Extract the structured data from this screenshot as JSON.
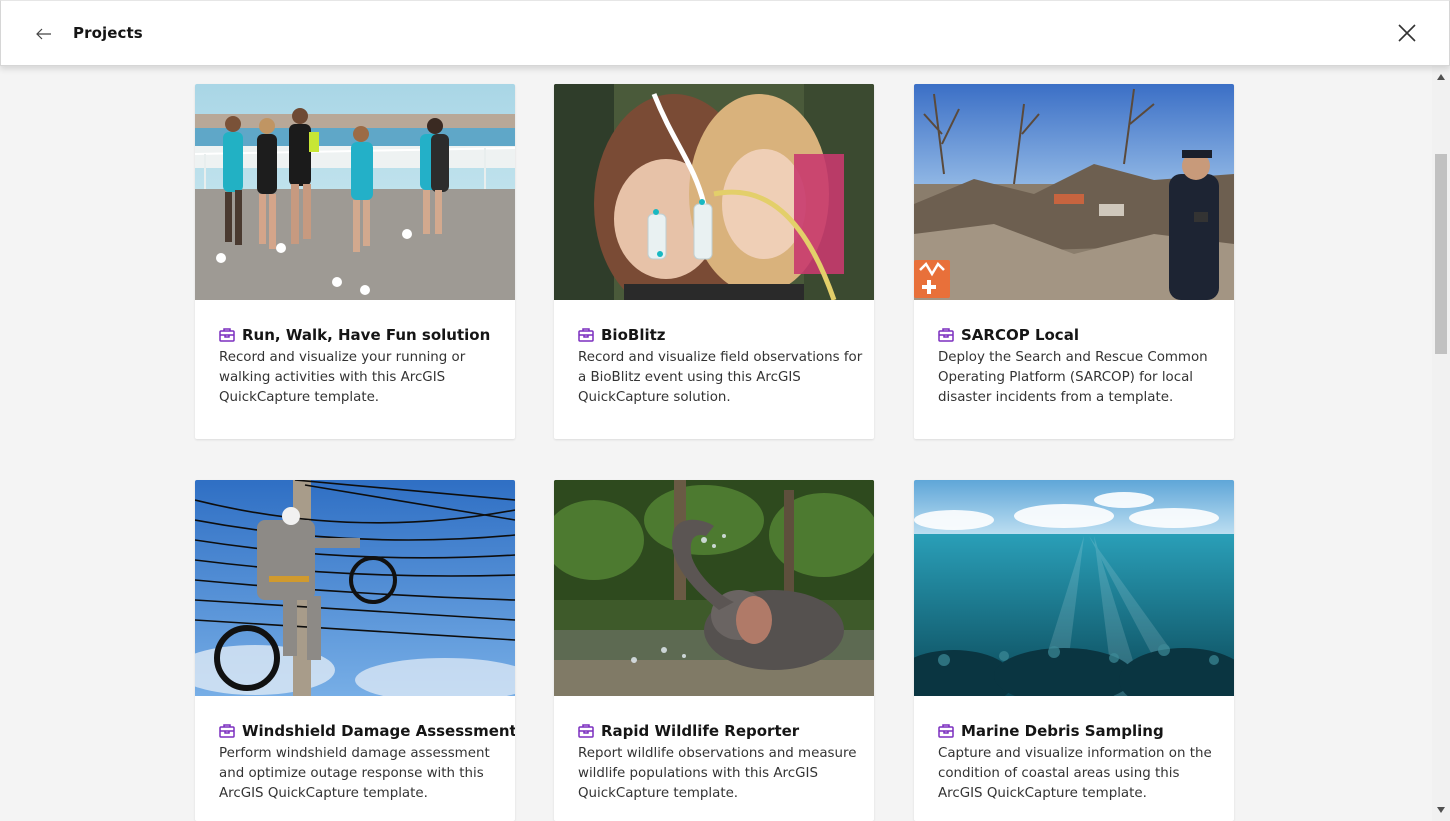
{
  "header": {
    "title": "Projects"
  },
  "colors": {
    "accent": "#7b2fbf",
    "background": "#f4f4f4",
    "card": "#ffffff"
  },
  "icons": {
    "back": "arrow-left-icon",
    "close": "close-icon",
    "project": "briefcase-project-icon"
  },
  "cards": [
    {
      "title": "Run, Walk, Have Fun solution",
      "description": "Record and visualize your running or walking activities with this ArcGIS QuickCapture template.",
      "image": "runners-on-boardwalk"
    },
    {
      "title": "BioBlitz",
      "description": "Record and visualize field observations for a BioBlitz event using this ArcGIS QuickCapture solution.",
      "image": "children-with-sample-tubes"
    },
    {
      "title": "SARCOP Local",
      "description": "Deploy the Search and Rescue Common Operating Platform (SARCOP) for local disaster incidents from a template.",
      "image": "disaster-debris-with-responder"
    },
    {
      "title": "Windshield Damage Assessment",
      "description": "Perform windshield damage assessment and optimize outage response with this ArcGIS QuickCapture template.",
      "image": "lineman-on-utility-pole"
    },
    {
      "title": "Rapid Wildlife Reporter",
      "description": "Report wildlife observations and measure wildlife populations with this ArcGIS QuickCapture template.",
      "image": "elephant-in-river"
    },
    {
      "title": "Marine Debris Sampling",
      "description": "Capture and visualize information on the condition of coastal areas using this ArcGIS QuickCapture template.",
      "image": "underwater-reef"
    }
  ]
}
